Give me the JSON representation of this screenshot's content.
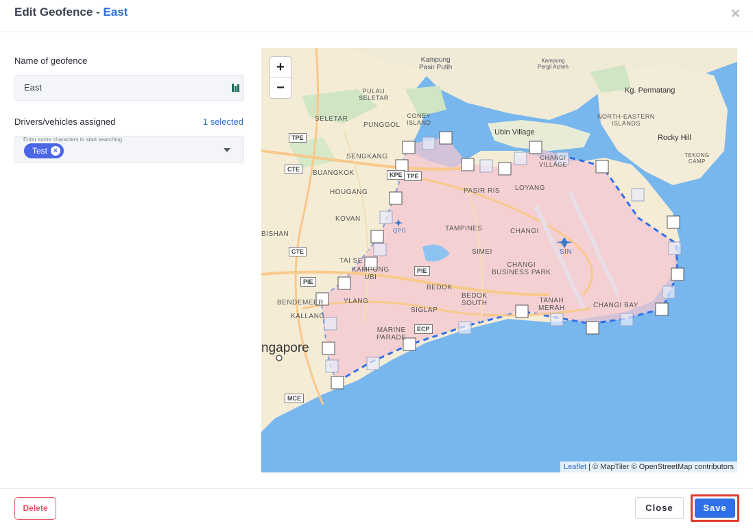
{
  "header": {
    "title_prefix": "Edit Geofence - ",
    "title_name": "East",
    "close_symbol": "✕"
  },
  "form": {
    "name_label": "Name of geofence",
    "name_value": "East",
    "assigned_label": "Drivers/vehicles assigned",
    "selected_count_text": "1 selected",
    "search_hint": "Enter some characters to start searching",
    "chips": [
      "Test"
    ]
  },
  "map": {
    "zoom_in": "+",
    "zoom_out": "−",
    "attribution_leaflet": "Leaflet",
    "attribution_rest": " | © MapTiler © OpenStreetMap contributors",
    "places": {
      "kampung_pasir_putih": "Kampung\nPasir Putih",
      "kampung_pergil": "Kampung\nPergil Acheh",
      "pulau_ubin": "PULAU\nSELETAR",
      "seletar": "SELETAR",
      "punggol": "PUNGGOL",
      "coney_island": "CONEY\nISLAND",
      "kg_permatang": "Kg. Permatang",
      "north_eastern_islands": "NORTH-EASTERN\nISLANDS",
      "rocky_hill": "Rocky Hill",
      "ubin_village": "Ubin Village",
      "changi_village": "CHANGI\nVILLAGE",
      "sengkang": "SENGKANG",
      "buangkok": "BUANGKOK",
      "hougang": "HOUGANG",
      "pasir_ris": "PASIR RIS",
      "loyang": "LOYANG",
      "kovan": "KOVAN",
      "tampines": "TAMPINES",
      "changi": "CHANGI",
      "bishan": "BISHAN",
      "simei": "SIMEI",
      "sin": "SIN",
      "tai_seng": "TAI SE",
      "kampong_ubi": "KAMPONG\nUBI",
      "changi_business_park": "CHANGI\nBUSINESS PARK",
      "bedok": "BEDOK",
      "bedok_south": "BEDOK\nSOUTH",
      "bendemeer": "BENDEMEER",
      "geylang": "YLANG",
      "kallang": "KALLANG",
      "siglap": "SIGLAP",
      "tanah_merah": "TANAH\nMERAH",
      "changi_bay": "CHANGI BAY",
      "marine_parade": "MARINE\nPARADE",
      "singapore": "ngapore",
      "qpg": "QPG",
      "tekong_camp": "TEKONG\nCAMP"
    },
    "roads": [
      "TPE",
      "CTE",
      "PIE",
      "ECP",
      "MCE",
      "KPE",
      "TPE",
      "PIE"
    ]
  },
  "footer": {
    "delete_label": "Delete",
    "close_label": "Close",
    "save_label": "Save"
  },
  "colors": {
    "accent": "#2e6fd0",
    "save": "#2f6fe8",
    "delete": "#e05565",
    "highlight_border": "#e03a2f",
    "geofence_fill": "#f3c7d0"
  }
}
